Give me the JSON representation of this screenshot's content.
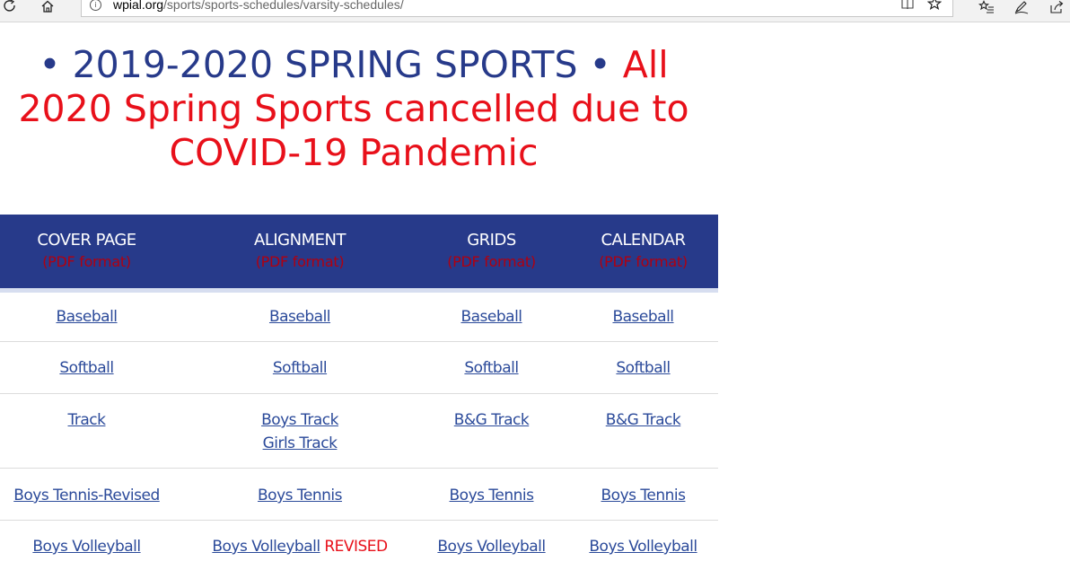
{
  "browser": {
    "url_host": "wpial.org",
    "url_path": "/sports/sports-schedules/varsity-schedules/",
    "icons": [
      "refresh-icon",
      "home-icon",
      "info-icon",
      "reading-view-icon",
      "favorite-star-icon",
      "favorites-list-icon",
      "pen-icon",
      "share-icon"
    ]
  },
  "heading": {
    "part1": "• 2019-2020 SPRING SPORTS •",
    "part2": "All 2020 Spring Sports cancelled due to COVID-19 Pandemic",
    "colors": {
      "blue": "#273a8a",
      "red": "#e8101a"
    }
  },
  "table": {
    "columns": [
      {
        "title": "COVER PAGE",
        "sub": "(PDF format)"
      },
      {
        "title": "ALIGNMENT",
        "sub": "(PDF format)"
      },
      {
        "title": "GRIDS",
        "sub": "(PDF format)"
      },
      {
        "title": "CALENDAR",
        "sub": "(PDF format)"
      }
    ],
    "rows": [
      {
        "cover": "Baseball",
        "alignment": [
          "Baseball"
        ],
        "grids": "Baseball",
        "calendar": "Baseball"
      },
      {
        "cover": "Softball",
        "alignment": [
          "Softball"
        ],
        "grids": "Softball",
        "calendar": "Softball"
      },
      {
        "cover": "Track",
        "alignment": [
          "Boys Track",
          "Girls Track"
        ],
        "grids": "B&G Track",
        "calendar": "B&G Track"
      },
      {
        "cover": "Boys Tennis-Revised",
        "alignment": [
          "Boys Tennis"
        ],
        "grids": "Boys Tennis",
        "calendar": "Boys Tennis"
      },
      {
        "cover": "Boys Volleyball",
        "alignment": [
          "Boys Volleyball"
        ],
        "alignment_note": "REVISED",
        "grids": "Boys Volleyball",
        "calendar": "Boys Volleyball"
      }
    ]
  }
}
